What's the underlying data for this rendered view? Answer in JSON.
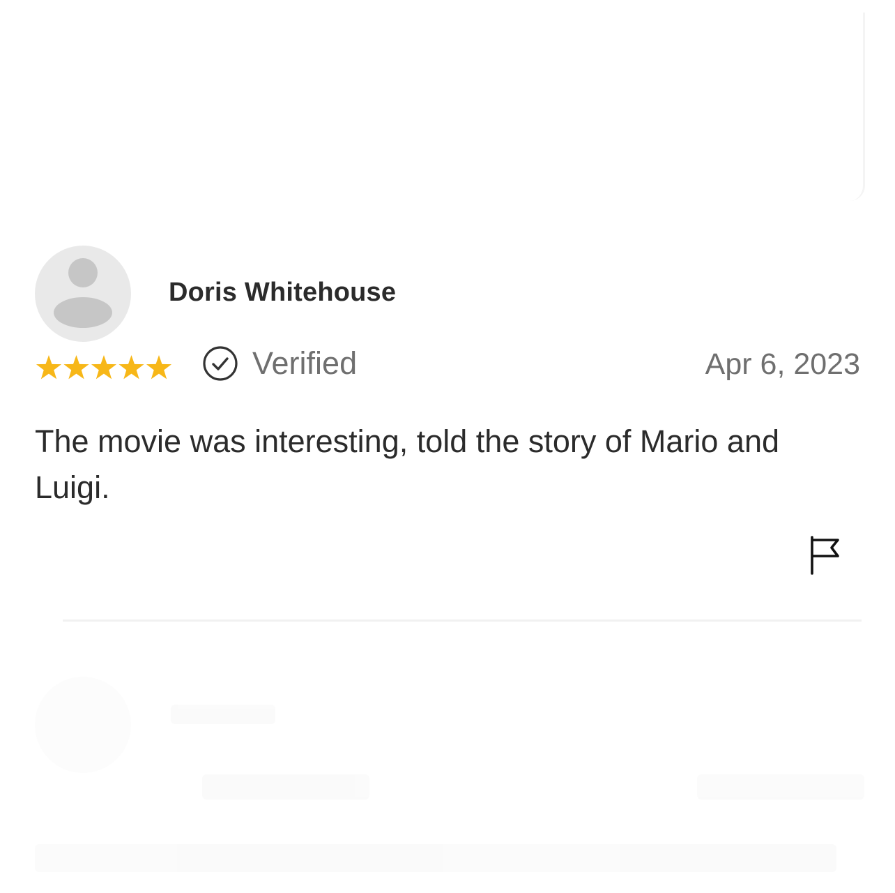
{
  "review": {
    "author_name": "Doris Whitehouse",
    "rating": 5,
    "rating_max": 5,
    "verified_label": "Verified",
    "date": "Apr 6, 2023",
    "body": "The movie was interesting, told the story of Mario and Luigi."
  },
  "icons": {
    "avatar": "default-user-avatar-icon",
    "star": "star-icon",
    "verified": "check-circle-icon",
    "report": "flag-icon"
  },
  "colors": {
    "star": "#f7b718",
    "text_primary": "#2b2b2b",
    "text_secondary": "#6f6f6f",
    "avatar_bg": "#e9e9e9",
    "avatar_fg": "#c6c6c6"
  }
}
